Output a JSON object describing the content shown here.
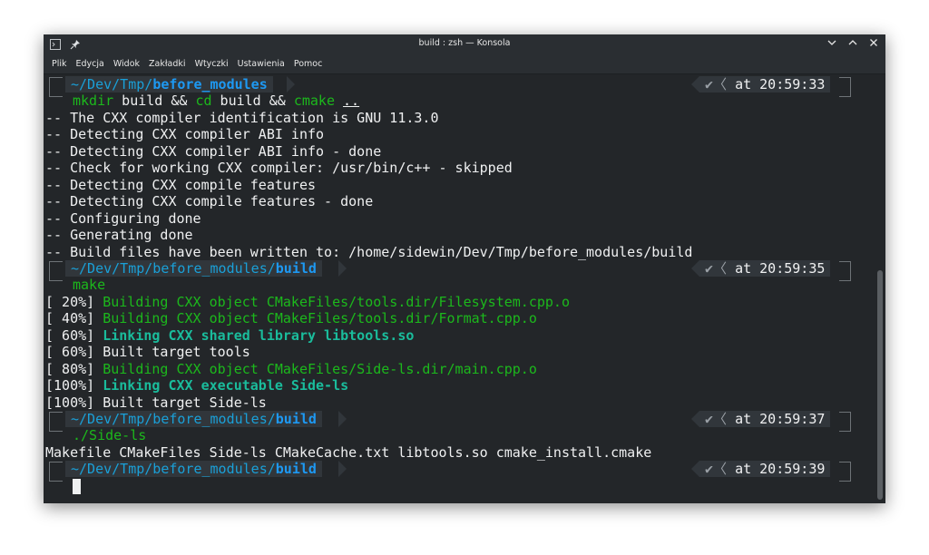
{
  "window": {
    "title": "build : zsh — Konsola"
  },
  "menu": [
    "Plik",
    "Edycja",
    "Widok",
    "Zakładki",
    "Wtyczki",
    "Ustawienia",
    "Pomoc"
  ],
  "prompts": [
    {
      "path_prefix": "~/Dev/Tmp/",
      "path_last": "before_modules",
      "check": "✔",
      "time_label": "at 20:59:33"
    },
    {
      "path_prefix": "~/Dev/Tmp/before_modules/",
      "path_last": "build",
      "check": "✔",
      "time_label": "at 20:59:35"
    },
    {
      "path_prefix": "~/Dev/Tmp/before_modules/",
      "path_last": "build",
      "check": "✔",
      "time_label": "at 20:59:37"
    },
    {
      "path_prefix": "~/Dev/Tmp/before_modules/",
      "path_last": "build",
      "check": "✔",
      "time_label": "at 20:59:39"
    }
  ],
  "commands": {
    "cmd1": {
      "mkdir": "mkdir",
      "rest1": " build && ",
      "cd": "cd",
      "rest2": " build && ",
      "cmake": "cmake",
      "sp": " ",
      "arg": ".."
    },
    "cmd2": "make",
    "cmd3": "./Side-ls"
  },
  "cmake_output": [
    "-- The CXX compiler identification is GNU 11.3.0",
    "-- Detecting CXX compiler ABI info",
    "-- Detecting CXX compiler ABI info - done",
    "-- Check for working CXX compiler: /usr/bin/c++ - skipped",
    "-- Detecting CXX compile features",
    "-- Detecting CXX compile features - done",
    "-- Configuring done",
    "-- Generating done",
    "-- Build files have been written to: /home/sidewin/Dev/Tmp/before_modules/build"
  ],
  "make_output": [
    {
      "pct": "[ 20%] ",
      "text": "Building CXX object CMakeFiles/tools.dir/Filesystem.cpp.o",
      "style": "green"
    },
    {
      "pct": "[ 40%] ",
      "text": "Building CXX object CMakeFiles/tools.dir/Format.cpp.o",
      "style": "green"
    },
    {
      "pct": "[ 60%] ",
      "text": "Linking CXX shared library libtools.so",
      "style": "boldgreen"
    },
    {
      "pct": "[ 60%] ",
      "text": "Built target tools",
      "style": "plain"
    },
    {
      "pct": "[ 80%] ",
      "text": "Building CXX object CMakeFiles/Side-ls.dir/main.cpp.o",
      "style": "green"
    },
    {
      "pct": "[100%] ",
      "text": "Linking CXX executable Side-ls",
      "style": "boldgreen"
    },
    {
      "pct": "[100%] ",
      "text": "Built target Side-ls",
      "style": "plain"
    }
  ],
  "ls_output": "Makefile CMakeFiles Side-ls CMakeCache.txt libtools.so cmake_install.cmake",
  "colors": {
    "background": "#232629",
    "foreground": "#eff0f1",
    "green": "#1cb81c",
    "bold_green": "#1abc9c",
    "path_blue": "#1d99f3"
  },
  "icons": [
    "konsole-icon",
    "pin-icon",
    "chevron-down-icon",
    "maximize-icon",
    "close-icon"
  ]
}
